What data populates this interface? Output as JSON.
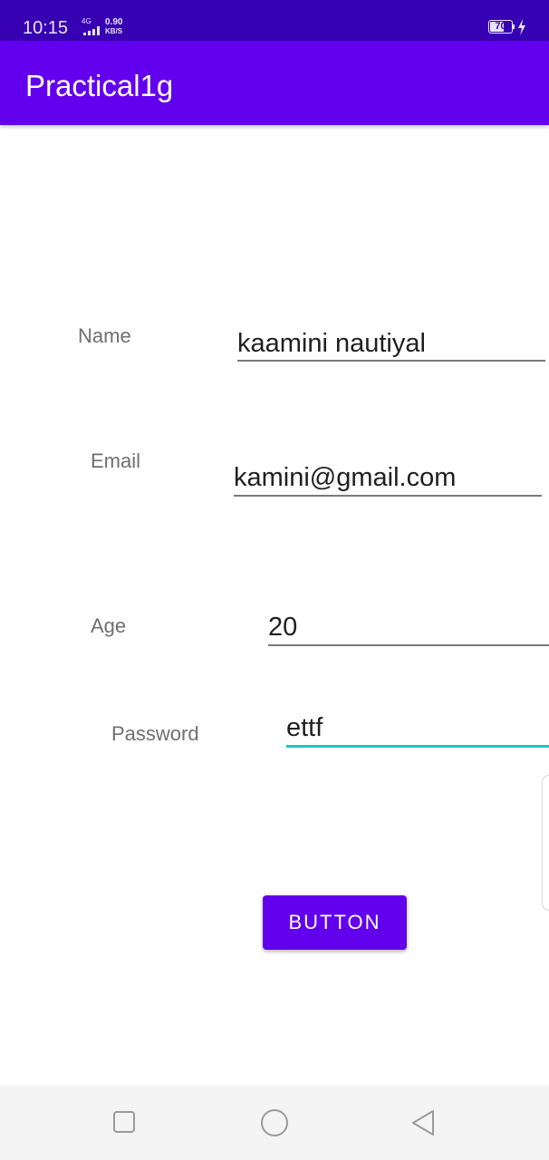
{
  "status_bar": {
    "time": "10:15",
    "network": "4G",
    "speed_value": "0.90",
    "speed_unit": "KB/S",
    "battery_percent": "70",
    "battery_level": 0.7
  },
  "app_bar": {
    "title": "Practical1g"
  },
  "form": {
    "name_label": "Name",
    "name_value": "kaamini nautiyal",
    "email_label": "Email",
    "email_value": "kamini@gmail.com",
    "age_label": "Age",
    "age_value": "20",
    "password_label": "Password",
    "password_value": "ettf"
  },
  "button": {
    "label": "BUTTON"
  },
  "nav_bar": {
    "icons": [
      "recents-square-icon",
      "home-circle-icon",
      "back-triangle-icon"
    ]
  },
  "colors": {
    "status_bar": "#3700b3",
    "primary": "#6200ee",
    "focus_underline": "#1bc6c0",
    "label_text": "#6f6f6f"
  }
}
